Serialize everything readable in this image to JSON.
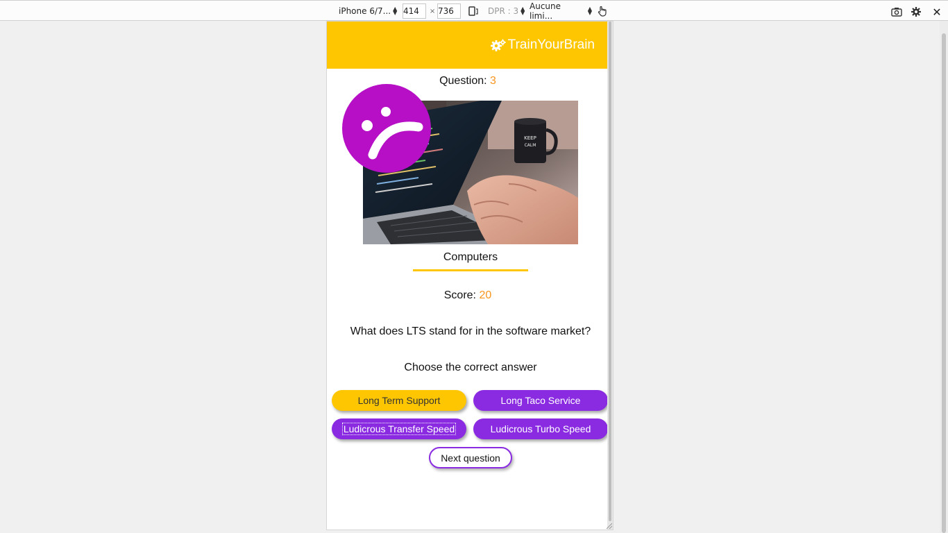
{
  "toolbar": {
    "device": "iPhone 6/7...",
    "width": "414",
    "height": "736",
    "times": "×",
    "dpr": "DPR : 3",
    "throttling": "Aucune limi...",
    "close": "✕"
  },
  "header": {
    "brand": "TrainYourBrain",
    "background": "#fec601"
  },
  "quiz": {
    "question_label": "Question:",
    "question_number": "3",
    "category": "Computers",
    "score_label": "Score:",
    "score_value": "20",
    "question_text": "What does LTS stand for in the software market?",
    "instruction": "Choose the correct answer",
    "answers": [
      {
        "label": "Long Term Support",
        "state": "correct"
      },
      {
        "label": "Long Taco Service",
        "state": "default"
      },
      {
        "label": "Ludicrous Transfer Speed",
        "state": "focused"
      },
      {
        "label": "Ludicrous Turbo Speed",
        "state": "default"
      }
    ],
    "next_label": "Next question",
    "feedback_icon": "sad-face-icon"
  },
  "colors": {
    "accent_yellow": "#fec601",
    "accent_purple": "#8a2be2",
    "number_orange": "#f7941d",
    "sad_face": "#b60fc5"
  }
}
